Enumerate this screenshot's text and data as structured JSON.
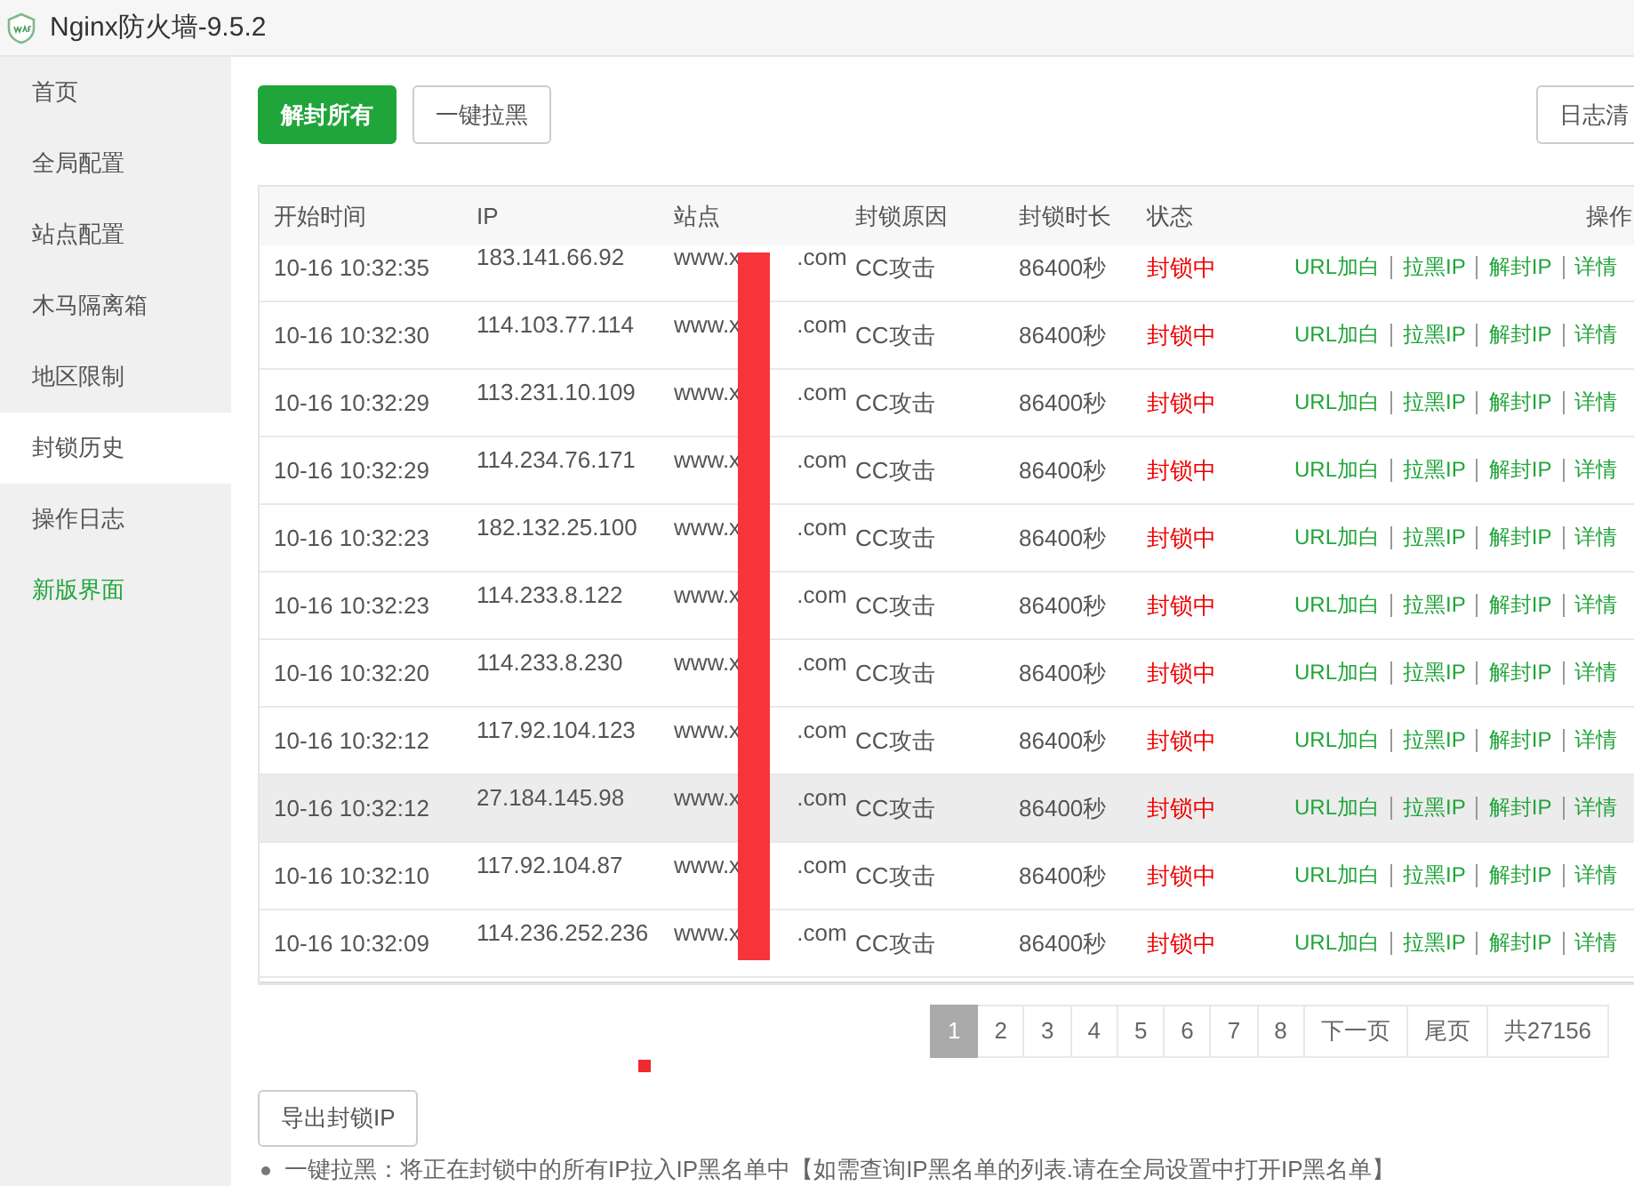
{
  "window": {
    "title": "Nginx防火墙-9.5.2"
  },
  "sidebar": {
    "items": [
      {
        "label": "首页",
        "selected": false,
        "kind": "normal"
      },
      {
        "label": "全局配置",
        "selected": false,
        "kind": "normal"
      },
      {
        "label": "站点配置",
        "selected": false,
        "kind": "normal"
      },
      {
        "label": "木马隔离箱",
        "selected": false,
        "kind": "normal"
      },
      {
        "label": "地区限制",
        "selected": false,
        "kind": "normal"
      },
      {
        "label": "封锁历史",
        "selected": true,
        "kind": "normal"
      },
      {
        "label": "操作日志",
        "selected": false,
        "kind": "normal"
      },
      {
        "label": "新版界面",
        "selected": false,
        "kind": "highlight"
      }
    ]
  },
  "toolbar": {
    "buttons": [
      {
        "label": "解封所有",
        "kind": "primary"
      },
      {
        "label": "一键拉黑",
        "kind": "default"
      }
    ],
    "right_button": "日志清"
  },
  "table": {
    "columns": [
      "开始时间",
      "IP",
      "站点",
      "封锁原因",
      "封锁时长",
      "状态",
      "操作"
    ],
    "rows": [
      {
        "time": "10-16 10:32:35",
        "ip": "183.141.66.92",
        "site": "www.x .com",
        "reason": "CC攻击",
        "duration": "86400秒",
        "status": "封锁中",
        "actions": [
          "URL加白",
          "拉黑IP",
          "解封IP",
          "详情"
        ],
        "highlighted": false
      },
      {
        "time": "10-16 10:32:30",
        "ip": "114.103.77.114",
        "site": "www.x .com",
        "reason": "CC攻击",
        "duration": "86400秒",
        "status": "封锁中",
        "actions": [
          "URL加白",
          "拉黑IP",
          "解封IP",
          "详情"
        ],
        "highlighted": false
      },
      {
        "time": "10-16 10:32:29",
        "ip": "113.231.10.109",
        "site": "www.x .com",
        "reason": "CC攻击",
        "duration": "86400秒",
        "status": "封锁中",
        "actions": [
          "URL加白",
          "拉黑IP",
          "解封IP",
          "详情"
        ],
        "highlighted": false
      },
      {
        "time": "10-16 10:32:29",
        "ip": "114.234.76.171",
        "site": "www.x .com",
        "reason": "CC攻击",
        "duration": "86400秒",
        "status": "封锁中",
        "actions": [
          "URL加白",
          "拉黑IP",
          "解封IP",
          "详情"
        ],
        "highlighted": false
      },
      {
        "time": "10-16 10:32:23",
        "ip": "182.132.25.100",
        "site": "www.x .com",
        "reason": "CC攻击",
        "duration": "86400秒",
        "status": "封锁中",
        "actions": [
          "URL加白",
          "拉黑IP",
          "解封IP",
          "详情"
        ],
        "highlighted": false
      },
      {
        "time": "10-16 10:32:23",
        "ip": "114.233.8.122",
        "site": "www.x .com",
        "reason": "CC攻击",
        "duration": "86400秒",
        "status": "封锁中",
        "actions": [
          "URL加白",
          "拉黑IP",
          "解封IP",
          "详情"
        ],
        "highlighted": false
      },
      {
        "time": "10-16 10:32:20",
        "ip": "114.233.8.230",
        "site": "www.x .com",
        "reason": "CC攻击",
        "duration": "86400秒",
        "status": "封锁中",
        "actions": [
          "URL加白",
          "拉黑IP",
          "解封IP",
          "详情"
        ],
        "highlighted": false
      },
      {
        "time": "10-16 10:32:12",
        "ip": "117.92.104.123",
        "site": "www.x .com",
        "reason": "CC攻击",
        "duration": "86400秒",
        "status": "封锁中",
        "actions": [
          "URL加白",
          "拉黑IP",
          "解封IP",
          "详情"
        ],
        "highlighted": false
      },
      {
        "time": "10-16 10:32:12",
        "ip": "27.184.145.98",
        "site": "www.x .com",
        "reason": "CC攻击",
        "duration": "86400秒",
        "status": "封锁中",
        "actions": [
          "URL加白",
          "拉黑IP",
          "解封IP",
          "详情"
        ],
        "highlighted": true
      },
      {
        "time": "10-16 10:32:10",
        "ip": "117.92.104.87",
        "site": "www.x .com",
        "reason": "CC攻击",
        "duration": "86400秒",
        "status": "封锁中",
        "actions": [
          "URL加白",
          "拉黑IP",
          "解封IP",
          "详情"
        ],
        "highlighted": false
      },
      {
        "time": "10-16 10:32:09",
        "ip": "114.236.252.236",
        "site": "www.x .com",
        "reason": "CC攻击",
        "duration": "86400秒",
        "status": "封锁中",
        "actions": [
          "URL加白",
          "拉黑IP",
          "解封IP",
          "详情"
        ],
        "highlighted": false
      }
    ]
  },
  "pagination": {
    "pages": [
      {
        "label": "1",
        "selected": true
      },
      {
        "label": "2",
        "selected": false
      },
      {
        "label": "3",
        "selected": false
      },
      {
        "label": "4",
        "selected": false
      },
      {
        "label": "5",
        "selected": false
      },
      {
        "label": "6",
        "selected": false
      },
      {
        "label": "7",
        "selected": false
      },
      {
        "label": "8",
        "selected": false
      }
    ],
    "next": "下一页",
    "last": "尾页",
    "total": "共27156"
  },
  "footer": {
    "button": "导出封锁IP",
    "notes": [
      "一键拉黑：将正在封锁中的所有IP拉入IP黑名单中【如需查询IP黑名单的列表.请在全局设置中打开IP黑名单】"
    ]
  }
}
